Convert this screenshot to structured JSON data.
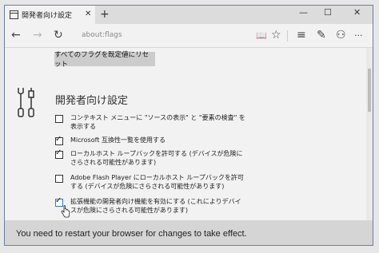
{
  "tab": {
    "title": "開発者向け設定",
    "close": "✕"
  },
  "new_tab": "+",
  "window_buttons": {
    "minimize": "—",
    "maximize": "☐",
    "close": "✕"
  },
  "nav": {
    "back": "←",
    "forward": "→",
    "refresh": "↻",
    "address": "about:flags",
    "reading_view": "📖",
    "favorite": "☆",
    "hub": "≡",
    "note": "✎",
    "share": "⚇",
    "more": "···"
  },
  "reset_button": "すべてのフラグを既定値にリセット",
  "section_title": "開発者向け設定",
  "options": [
    {
      "label": "コンテキスト メニューに \"ソースの表示\" と \"要素の検査\" を表示する",
      "checked": false
    },
    {
      "label": "Microsoft 互換性一覧を使用する",
      "checked": true
    },
    {
      "label": "ローカルホスト ループバックを許可する (デバイスが危険にさらされる可能性があります)",
      "checked": true
    },
    {
      "label": "Adobe Flash Player にローカルホスト ループバックを許可する (デバイスが危険にさらされる可能性があります)",
      "checked": false
    },
    {
      "label": "拡張機能の開発者向け機能を有効にする (これによりデバイスが危険にさらされる可能性があります)",
      "checked": true
    }
  ],
  "infobar": {
    "message": "You need to restart your browser for changes to take effect."
  }
}
